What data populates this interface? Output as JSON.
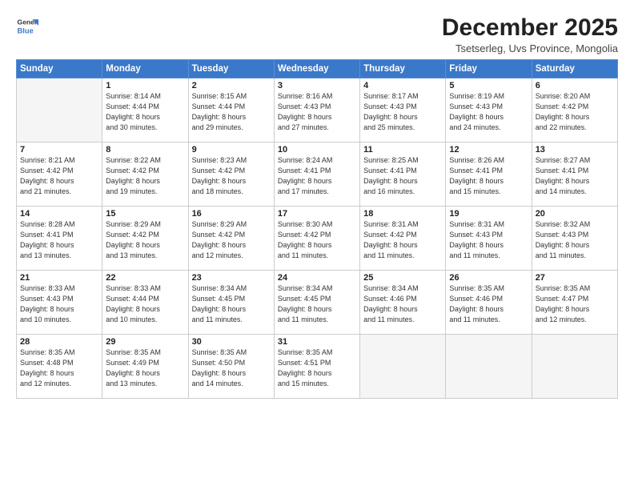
{
  "logo": {
    "line1": "General",
    "line2": "Blue"
  },
  "title": "December 2025",
  "subtitle": "Tsetserleg, Uvs Province, Mongolia",
  "header_days": [
    "Sunday",
    "Monday",
    "Tuesday",
    "Wednesday",
    "Thursday",
    "Friday",
    "Saturday"
  ],
  "weeks": [
    [
      {
        "date": "",
        "info": ""
      },
      {
        "date": "1",
        "info": "Sunrise: 8:14 AM\nSunset: 4:44 PM\nDaylight: 8 hours\nand 30 minutes."
      },
      {
        "date": "2",
        "info": "Sunrise: 8:15 AM\nSunset: 4:44 PM\nDaylight: 8 hours\nand 29 minutes."
      },
      {
        "date": "3",
        "info": "Sunrise: 8:16 AM\nSunset: 4:43 PM\nDaylight: 8 hours\nand 27 minutes."
      },
      {
        "date": "4",
        "info": "Sunrise: 8:17 AM\nSunset: 4:43 PM\nDaylight: 8 hours\nand 25 minutes."
      },
      {
        "date": "5",
        "info": "Sunrise: 8:19 AM\nSunset: 4:43 PM\nDaylight: 8 hours\nand 24 minutes."
      },
      {
        "date": "6",
        "info": "Sunrise: 8:20 AM\nSunset: 4:42 PM\nDaylight: 8 hours\nand 22 minutes."
      }
    ],
    [
      {
        "date": "7",
        "info": "Sunrise: 8:21 AM\nSunset: 4:42 PM\nDaylight: 8 hours\nand 21 minutes."
      },
      {
        "date": "8",
        "info": "Sunrise: 8:22 AM\nSunset: 4:42 PM\nDaylight: 8 hours\nand 19 minutes."
      },
      {
        "date": "9",
        "info": "Sunrise: 8:23 AM\nSunset: 4:42 PM\nDaylight: 8 hours\nand 18 minutes."
      },
      {
        "date": "10",
        "info": "Sunrise: 8:24 AM\nSunset: 4:41 PM\nDaylight: 8 hours\nand 17 minutes."
      },
      {
        "date": "11",
        "info": "Sunrise: 8:25 AM\nSunset: 4:41 PM\nDaylight: 8 hours\nand 16 minutes."
      },
      {
        "date": "12",
        "info": "Sunrise: 8:26 AM\nSunset: 4:41 PM\nDaylight: 8 hours\nand 15 minutes."
      },
      {
        "date": "13",
        "info": "Sunrise: 8:27 AM\nSunset: 4:41 PM\nDaylight: 8 hours\nand 14 minutes."
      }
    ],
    [
      {
        "date": "14",
        "info": "Sunrise: 8:28 AM\nSunset: 4:41 PM\nDaylight: 8 hours\nand 13 minutes."
      },
      {
        "date": "15",
        "info": "Sunrise: 8:29 AM\nSunset: 4:42 PM\nDaylight: 8 hours\nand 13 minutes."
      },
      {
        "date": "16",
        "info": "Sunrise: 8:29 AM\nSunset: 4:42 PM\nDaylight: 8 hours\nand 12 minutes."
      },
      {
        "date": "17",
        "info": "Sunrise: 8:30 AM\nSunset: 4:42 PM\nDaylight: 8 hours\nand 11 minutes."
      },
      {
        "date": "18",
        "info": "Sunrise: 8:31 AM\nSunset: 4:42 PM\nDaylight: 8 hours\nand 11 minutes."
      },
      {
        "date": "19",
        "info": "Sunrise: 8:31 AM\nSunset: 4:43 PM\nDaylight: 8 hours\nand 11 minutes."
      },
      {
        "date": "20",
        "info": "Sunrise: 8:32 AM\nSunset: 4:43 PM\nDaylight: 8 hours\nand 11 minutes."
      }
    ],
    [
      {
        "date": "21",
        "info": "Sunrise: 8:33 AM\nSunset: 4:43 PM\nDaylight: 8 hours\nand 10 minutes."
      },
      {
        "date": "22",
        "info": "Sunrise: 8:33 AM\nSunset: 4:44 PM\nDaylight: 8 hours\nand 10 minutes."
      },
      {
        "date": "23",
        "info": "Sunrise: 8:34 AM\nSunset: 4:45 PM\nDaylight: 8 hours\nand 11 minutes."
      },
      {
        "date": "24",
        "info": "Sunrise: 8:34 AM\nSunset: 4:45 PM\nDaylight: 8 hours\nand 11 minutes."
      },
      {
        "date": "25",
        "info": "Sunrise: 8:34 AM\nSunset: 4:46 PM\nDaylight: 8 hours\nand 11 minutes."
      },
      {
        "date": "26",
        "info": "Sunrise: 8:35 AM\nSunset: 4:46 PM\nDaylight: 8 hours\nand 11 minutes."
      },
      {
        "date": "27",
        "info": "Sunrise: 8:35 AM\nSunset: 4:47 PM\nDaylight: 8 hours\nand 12 minutes."
      }
    ],
    [
      {
        "date": "28",
        "info": "Sunrise: 8:35 AM\nSunset: 4:48 PM\nDaylight: 8 hours\nand 12 minutes."
      },
      {
        "date": "29",
        "info": "Sunrise: 8:35 AM\nSunset: 4:49 PM\nDaylight: 8 hours\nand 13 minutes."
      },
      {
        "date": "30",
        "info": "Sunrise: 8:35 AM\nSunset: 4:50 PM\nDaylight: 8 hours\nand 14 minutes."
      },
      {
        "date": "31",
        "info": "Sunrise: 8:35 AM\nSunset: 4:51 PM\nDaylight: 8 hours\nand 15 minutes."
      },
      {
        "date": "",
        "info": ""
      },
      {
        "date": "",
        "info": ""
      },
      {
        "date": "",
        "info": ""
      }
    ]
  ]
}
